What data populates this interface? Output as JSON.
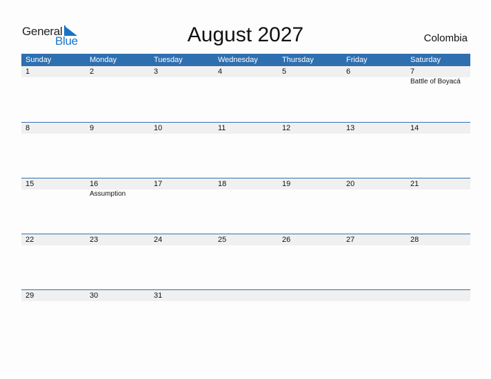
{
  "logo": {
    "line1": "General",
    "line2": "Blue"
  },
  "title": "August 2027",
  "country": "Colombia",
  "weekdays": [
    "Sunday",
    "Monday",
    "Tuesday",
    "Wednesday",
    "Thursday",
    "Friday",
    "Saturday"
  ],
  "weeks": [
    {
      "days": [
        "1",
        "2",
        "3",
        "4",
        "5",
        "6",
        "7"
      ],
      "events": [
        "",
        "",
        "",
        "",
        "",
        "",
        "Battle of Boyacá"
      ]
    },
    {
      "days": [
        "8",
        "9",
        "10",
        "11",
        "12",
        "13",
        "14"
      ],
      "events": [
        "",
        "",
        "",
        "",
        "",
        "",
        ""
      ]
    },
    {
      "days": [
        "15",
        "16",
        "17",
        "18",
        "19",
        "20",
        "21"
      ],
      "events": [
        "",
        "Assumption",
        "",
        "",
        "",
        "",
        ""
      ]
    },
    {
      "days": [
        "22",
        "23",
        "24",
        "25",
        "26",
        "27",
        "28"
      ],
      "events": [
        "",
        "",
        "",
        "",
        "",
        "",
        ""
      ]
    },
    {
      "days": [
        "29",
        "30",
        "31",
        "",
        "",
        "",
        ""
      ],
      "events": [
        "",
        "",
        "",
        "",
        "",
        "",
        ""
      ]
    }
  ],
  "colors": {
    "header": "#2e6fb0",
    "brand": "#1a73c8"
  }
}
